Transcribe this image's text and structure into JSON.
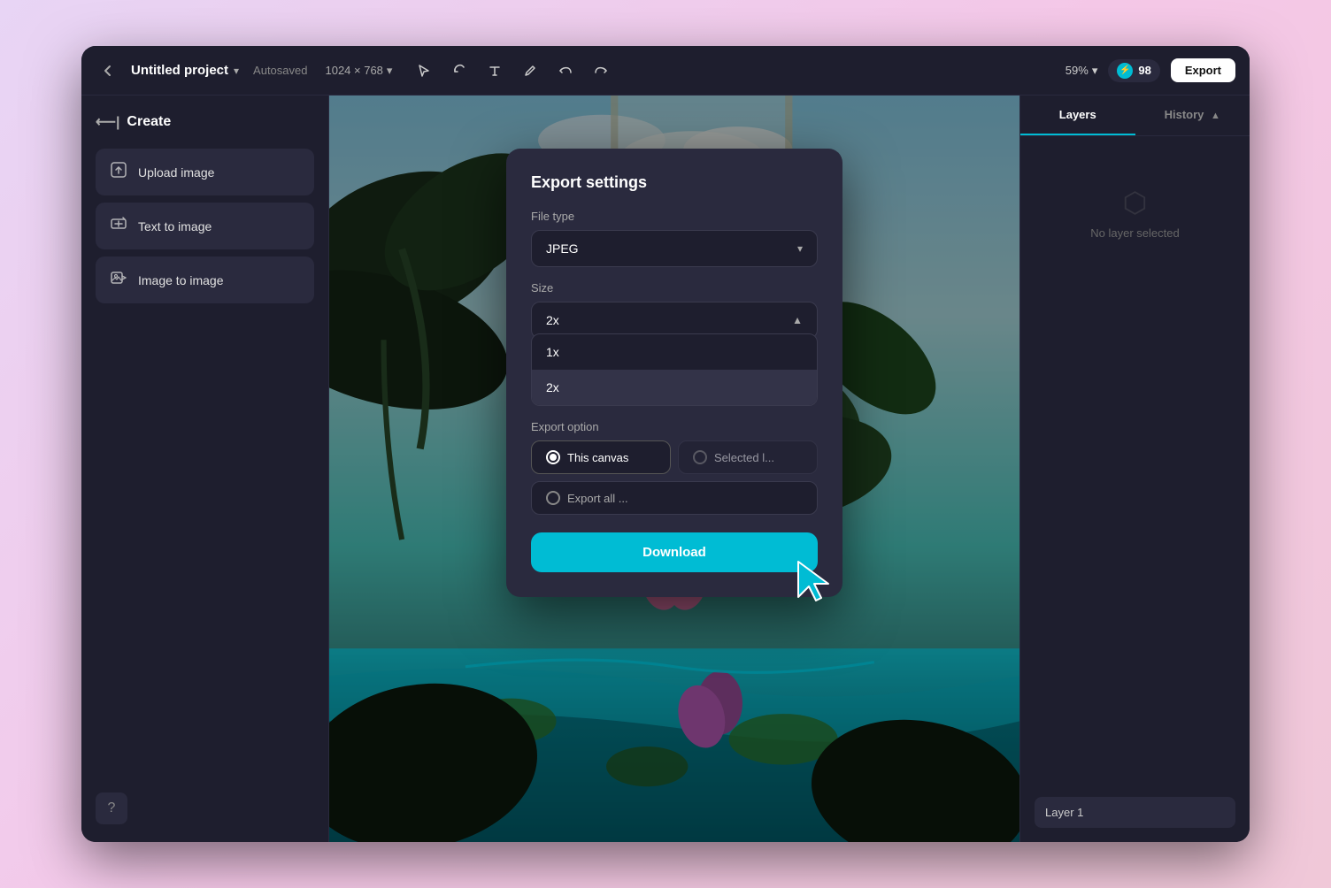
{
  "header": {
    "back_icon": "←",
    "project_title": "Untitled project",
    "dropdown_icon": "▾",
    "autosaved_label": "Autosaved",
    "canvas_size": "1024 × 768",
    "canvas_size_icon": "▾",
    "tools": [
      "▶",
      "↺",
      "T",
      "✏",
      "↩",
      "↪"
    ],
    "zoom_label": "59%",
    "zoom_icon": "▾",
    "credits_icon": "⚡",
    "credits_count": "98",
    "export_label": "Export"
  },
  "sidebar": {
    "header_icon": "←|",
    "header_label": "Create",
    "items": [
      {
        "id": "upload-image",
        "icon": "⬆",
        "label": "Upload image"
      },
      {
        "id": "text-to-image",
        "icon": "✦",
        "label": "Text to image"
      },
      {
        "id": "image-to-image",
        "icon": "🖼",
        "label": "Image to image"
      }
    ],
    "help_icon": "?"
  },
  "right_panel": {
    "tabs": [
      {
        "id": "layers",
        "label": "Layers",
        "active": true
      },
      {
        "id": "history",
        "label": "History",
        "active": false
      }
    ],
    "no_layer_text": "No layer selected",
    "layer1_label": "Layer 1"
  },
  "export_modal": {
    "title": "Export settings",
    "file_type_label": "File type",
    "file_type_value": "JPEG",
    "file_type_chevron": "▾",
    "size_label": "Size",
    "size_value": "2x",
    "size_chevron": "▲",
    "size_options": [
      {
        "id": "1x",
        "label": "1x",
        "selected": false
      },
      {
        "id": "2x",
        "label": "2x",
        "selected": true
      }
    ],
    "export_option_label": "Export option",
    "options": [
      {
        "id": "this-canvas",
        "label": "This canvas",
        "checked": true,
        "disabled": false
      },
      {
        "id": "selected",
        "label": "Selected l...",
        "checked": false,
        "disabled": true
      }
    ],
    "export_all_label": "Export all ...",
    "download_label": "Download"
  },
  "colors": {
    "accent": "#00bcd4",
    "bg_dark": "#1e1e2e",
    "bg_panel": "#2a2a3e",
    "text_primary": "#ffffff",
    "text_secondary": "#aaaaaa"
  }
}
